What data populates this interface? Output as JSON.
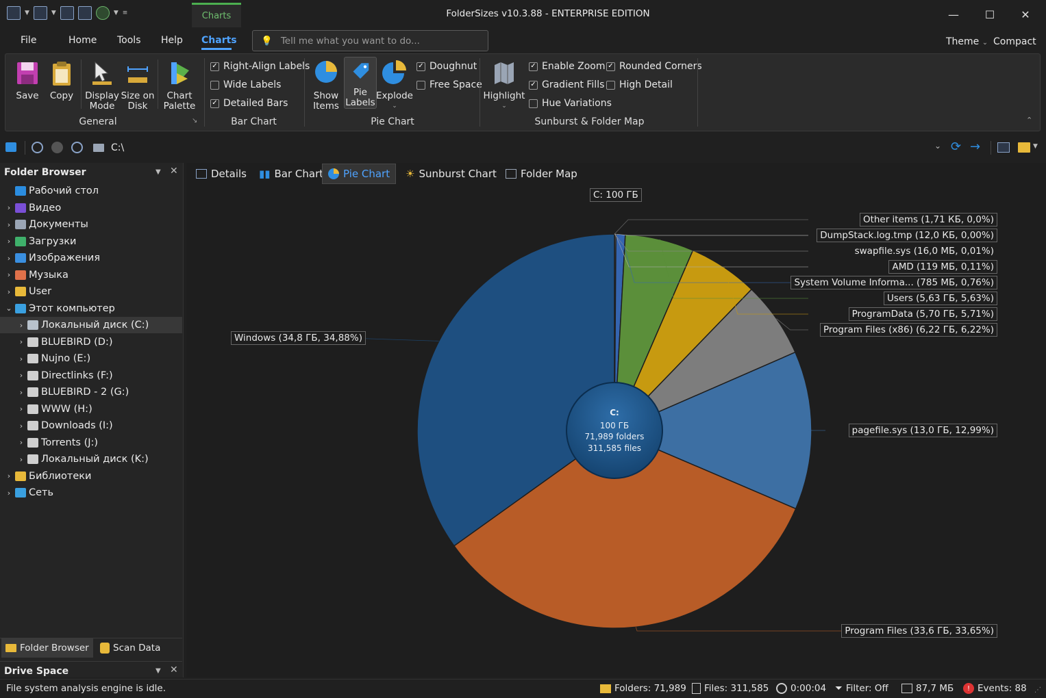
{
  "window": {
    "title": "FolderSizes v10.3.88 - ENTERPRISE EDITION",
    "context_tab": "Charts",
    "minimize": "—",
    "maximize": "☐",
    "close": "✕"
  },
  "menu": {
    "tabs": [
      "File",
      "Home",
      "Tools",
      "Help",
      "Charts"
    ],
    "search_placeholder": "Tell me what you want to do...",
    "theme": "Theme",
    "compact": "Compact"
  },
  "ribbon": {
    "general": {
      "label": "General",
      "save": "Save",
      "copy": "Copy",
      "display_mode": [
        "Display",
        "Mode"
      ],
      "size_on_disk": [
        "Size on",
        "Disk"
      ],
      "chart_palette": [
        "Chart",
        "Palette"
      ]
    },
    "bar_chart": {
      "label": "Bar Chart",
      "options": [
        {
          "label": "Right-Align Labels",
          "checked": true
        },
        {
          "label": "Wide Labels",
          "checked": false
        },
        {
          "label": "Detailed Bars",
          "checked": true
        }
      ]
    },
    "pie_chart": {
      "label": "Pie Chart",
      "show_items": [
        "Show",
        "Items"
      ],
      "pie_labels": [
        "Pie",
        "Labels"
      ],
      "explode": "Explode",
      "options": [
        {
          "label": "Doughnut",
          "checked": true
        },
        {
          "label": "Free Space",
          "checked": false
        }
      ]
    },
    "sunburst": {
      "label": "Sunburst & Folder Map",
      "highlight": "Highlight",
      "options_col1": [
        {
          "label": "Enable Zoom",
          "checked": true
        },
        {
          "label": "Gradient Fills",
          "checked": true
        },
        {
          "label": "Hue Variations",
          "checked": false
        }
      ],
      "options_col2": [
        {
          "label": "Rounded Corners",
          "checked": true
        },
        {
          "label": "High Detail",
          "checked": false
        }
      ]
    }
  },
  "address": {
    "path": "C:\\"
  },
  "folder_browser": {
    "title": "Folder Browser",
    "items": [
      {
        "label": "Рабочий стол",
        "level": 0,
        "chevron": "",
        "color": "#2b8de0"
      },
      {
        "label": "Видео",
        "level": 0,
        "chevron": "›",
        "color": "#7a4fd6"
      },
      {
        "label": "Документы",
        "level": 0,
        "chevron": "›",
        "color": "#9aa5b5"
      },
      {
        "label": "Загрузки",
        "level": 0,
        "chevron": "›",
        "color": "#3fb06b"
      },
      {
        "label": "Изображения",
        "level": 0,
        "chevron": "›",
        "color": "#3a8fe0"
      },
      {
        "label": "Музыка",
        "level": 0,
        "chevron": "›",
        "color": "#e0714a"
      },
      {
        "label": "User",
        "level": 0,
        "chevron": "›",
        "color": "#e8b93a"
      },
      {
        "label": "Этот компьютер",
        "level": 0,
        "chevron": "⌄",
        "color": "#3aa0e0"
      },
      {
        "label": "Локальный диск (C:)",
        "level": 1,
        "chevron": "›",
        "color": "#b8c2cc",
        "selected": true
      },
      {
        "label": "BLUEBIRD (D:)",
        "level": 1,
        "chevron": "›",
        "color": "#cfcfcf"
      },
      {
        "label": "Nujno (E:)",
        "level": 1,
        "chevron": "›",
        "color": "#cfcfcf"
      },
      {
        "label": "Directlinks (F:)",
        "level": 1,
        "chevron": "›",
        "color": "#cfcfcf"
      },
      {
        "label": "BLUEBIRD - 2 (G:)",
        "level": 1,
        "chevron": "›",
        "color": "#cfcfcf"
      },
      {
        "label": "WWW (H:)",
        "level": 1,
        "chevron": "›",
        "color": "#cfcfcf"
      },
      {
        "label": "Downloads (I:)",
        "level": 1,
        "chevron": "›",
        "color": "#cfcfcf"
      },
      {
        "label": "Torrents (J:)",
        "level": 1,
        "chevron": "›",
        "color": "#cfcfcf"
      },
      {
        "label": "Локальный диск (K:)",
        "level": 1,
        "chevron": "›",
        "color": "#cfcfcf"
      },
      {
        "label": "Библиотеки",
        "level": 0,
        "chevron": "›",
        "color": "#e8b93a"
      },
      {
        "label": "Сеть",
        "level": 0,
        "chevron": "›",
        "color": "#3aa0e0"
      }
    ],
    "bottom_tabs": [
      "Folder Browser",
      "Scan Data"
    ]
  },
  "drive_space": {
    "title": "Drive Space"
  },
  "view_tabs": [
    "Details",
    "Bar Chart",
    "Pie Chart",
    "Sunburst Chart",
    "Folder Map"
  ],
  "chart_data": {
    "type": "pie",
    "title": "C:  100 ГБ",
    "doughnut": true,
    "center": {
      "drive": "C:",
      "size": "100 ГБ",
      "folders": "71,989 folders",
      "files": "311,585 files"
    },
    "slices": [
      {
        "name": "Other items",
        "label": "Other items (1,71 КБ, 0,0%)",
        "value": 0.0,
        "color": "#7a7a7a"
      },
      {
        "name": "DumpStack.log.tmp",
        "label": "DumpStack.log.tmp (12,0 КБ, 0,00%)",
        "value": 0.0,
        "color": "#d0d0d0"
      },
      {
        "name": "swapfile.sys",
        "label": "swapfile.sys (16,0 МБ, 0,01%)",
        "value": 0.01,
        "color": "#8c8c8c"
      },
      {
        "name": "AMD",
        "label": "AMD (119 МБ, 0,11%)",
        "value": 0.11,
        "color": "#b0b0b0"
      },
      {
        "name": "System Volume Informa...",
        "label": "System Volume Informa... (785 МБ, 0,76%)",
        "value": 0.76,
        "color": "#3565b0"
      },
      {
        "name": "Users",
        "label": "Users (5,63 ГБ, 5,63%)",
        "value": 5.63,
        "color": "#5b8f3a"
      },
      {
        "name": "ProgramData",
        "label": "ProgramData (5,70 ГБ, 5,71%)",
        "value": 5.71,
        "color": "#c79a10"
      },
      {
        "name": "Program Files (x86)",
        "label": "Program Files (x86) (6,22 ГБ, 6,22%)",
        "value": 6.22,
        "color": "#7d7d7d"
      },
      {
        "name": "pagefile.sys",
        "label": "pagefile.sys (13,0 ГБ, 12,99%)",
        "value": 12.99,
        "color": "#3d6fa3"
      },
      {
        "name": "Program Files",
        "label": "Program Files (33,6 ГБ, 33,65%)",
        "value": 33.65,
        "color": "#b85c27"
      },
      {
        "name": "Windows",
        "label": "Windows (34,8 ГБ, 34,88%)",
        "value": 34.88,
        "color": "#1e4f80"
      }
    ]
  },
  "status": {
    "message": "File system analysis engine is idle.",
    "folders": "Folders: 71,989",
    "files": "Files: 311,585",
    "time": "0:00:04",
    "filter": "Filter: Off",
    "memory": "87,7 МБ",
    "events": "Events: 88"
  }
}
